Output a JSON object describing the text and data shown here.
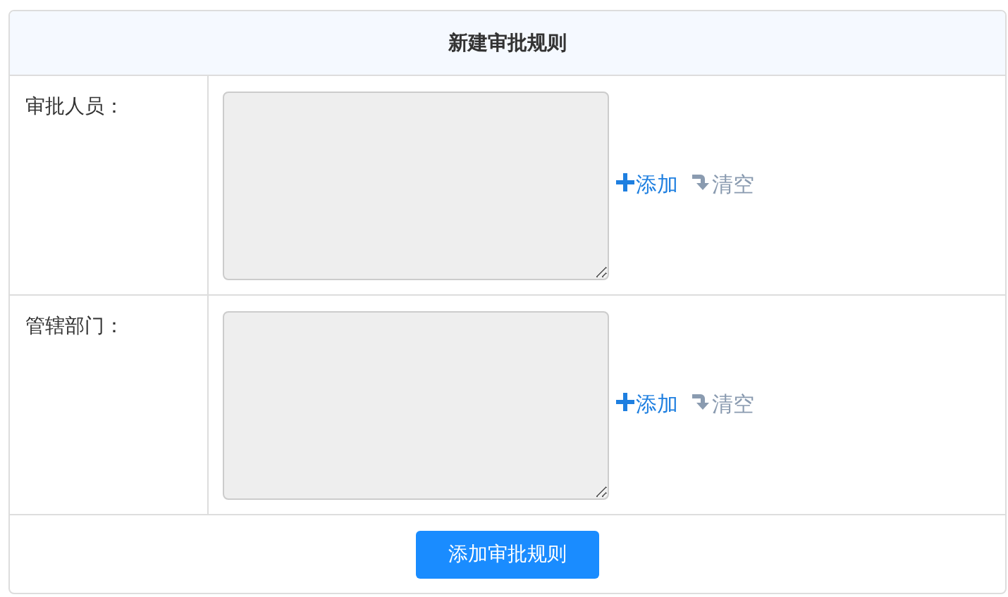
{
  "title": "新建审批规则",
  "rows": [
    {
      "label": "审批人员：",
      "add": "添加",
      "clear": "清空"
    },
    {
      "label": "管辖部门：",
      "add": "添加",
      "clear": "清空"
    }
  ],
  "submit": "添加审批规则"
}
